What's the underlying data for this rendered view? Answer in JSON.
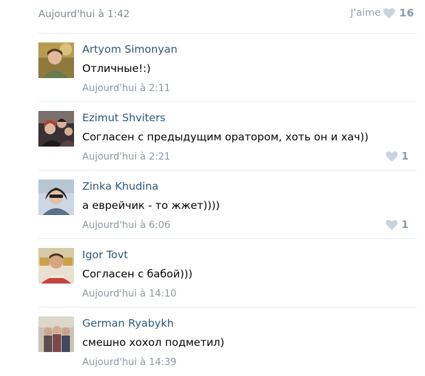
{
  "post": {
    "date": "Aujourd'hui à 1:42",
    "like_label": "J'aime",
    "like_count": "16"
  },
  "comments": [
    {
      "author": "Artyom Simonyan",
      "text": "Отличные!:)",
      "time": "Aujourd'hui à 2:11",
      "likes": ""
    },
    {
      "author": "Ezimut Shviters",
      "text": "Согласен с предыдущим оратором, хоть он и хач))",
      "time": "Aujourd'hui à 2:21",
      "likes": "1"
    },
    {
      "author": "Zinka Khudina",
      "text": "а еврейчик - то жжет))))",
      "time": "Aujourd'hui à 6:06",
      "likes": "1"
    },
    {
      "author": "Igor Tovt",
      "text": "Согласен с бабой)))",
      "time": "Aujourd'hui à 14:10",
      "likes": ""
    },
    {
      "author": "German Ryabykh",
      "text": "смешно хохол подметил)",
      "time": "Aujourd'hui à 14:39",
      "likes": ""
    }
  ],
  "icons": {
    "like": "heart-icon"
  },
  "colors": {
    "author_link": "#2b587a",
    "meta_text": "#8c97a3",
    "heart": "#c9d3dd",
    "divider": "#e7eaed"
  }
}
